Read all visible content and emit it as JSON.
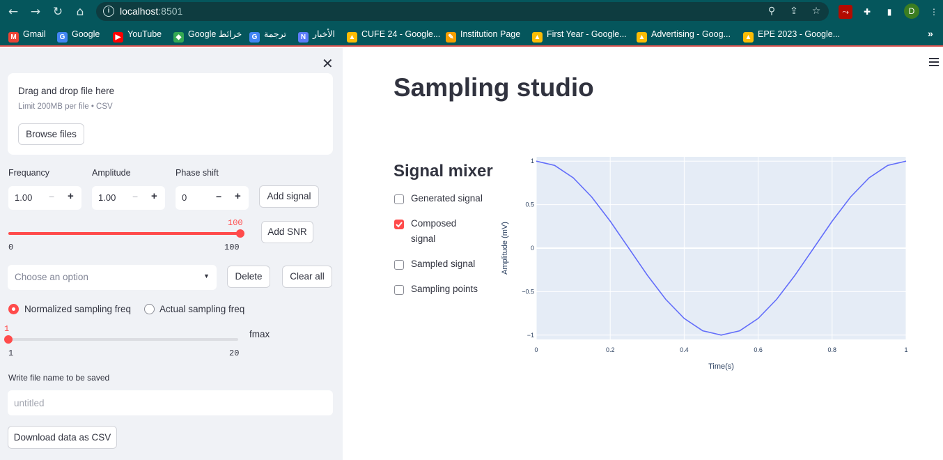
{
  "browser": {
    "url_host": "localhost",
    "url_port": ":8501",
    "avatar_letter": "D",
    "more_bookmarks": "»",
    "bookmarks": [
      {
        "label": "Gmail",
        "icon": "gmail-icon",
        "color": "#ea4335",
        "glyph": "M"
      },
      {
        "label": "Google",
        "icon": "google-icon",
        "color": "#4285f4",
        "glyph": "G"
      },
      {
        "label": "YouTube",
        "icon": "youtube-icon",
        "color": "#ff0000",
        "glyph": "▶"
      },
      {
        "label": "Google خرائط",
        "icon": "maps-icon",
        "color": "#34a853",
        "glyph": "◆"
      },
      {
        "label": "ترجمة",
        "icon": "translate-icon",
        "color": "#4285f4",
        "glyph": "G"
      },
      {
        "label": "الأخبار",
        "icon": "news-icon",
        "color": "#5c7cfa",
        "glyph": "N"
      },
      {
        "label": "CUFE 24 - Google...",
        "icon": "drive-icon",
        "color": "#fbbc05",
        "glyph": "▲"
      },
      {
        "label": "Institution Page",
        "icon": "institution-icon",
        "color": "#f59f00",
        "glyph": "✎"
      },
      {
        "label": "First Year - Google...",
        "icon": "drive-icon",
        "color": "#fbbc05",
        "glyph": "▲"
      },
      {
        "label": "Advertising - Goog...",
        "icon": "drive-icon",
        "color": "#fbbc05",
        "glyph": "▲"
      },
      {
        "label": "EPE 2023 - Google...",
        "icon": "drive-icon",
        "color": "#fbbc05",
        "glyph": "▲"
      }
    ]
  },
  "sidebar": {
    "uploader_title": "Drag and drop file here",
    "uploader_limit": "Limit 200MB per file • CSV",
    "browse_label": "Browse files",
    "frequency_label": "Frequancy",
    "frequency_value": "1.00",
    "amplitude_label": "Amplitude",
    "amplitude_value": "1.00",
    "phase_label": "Phase shift",
    "phase_value": "0",
    "minus": "−",
    "plus": "+",
    "add_signal_label": "Add signal",
    "snr_value": "100",
    "snr_min": "0",
    "snr_max": "100",
    "snr_fraction": 1.0,
    "add_snr_label": "Add SNR",
    "select_placeholder": "Choose an option",
    "delete_label": "Delete",
    "clear_label": "Clear all",
    "radio_normalized": "Normalized sampling freq",
    "radio_actual": "Actual sampling freq",
    "radio_selected": "normalized",
    "fs_value": "1",
    "fs_min": "1",
    "fs_max": "20",
    "fs_fraction": 0.0,
    "fmax_label": "fmax",
    "filename_label": "Write file name to be saved",
    "filename_placeholder": "untitled",
    "download_label": "Download data as CSV"
  },
  "main": {
    "title": "Sampling studio",
    "mixer_title": "Signal mixer",
    "checkboxes": [
      {
        "label": "Generated signal",
        "checked": false
      },
      {
        "label": "Composed signal",
        "checked": true
      },
      {
        "label": "Sampled signal",
        "checked": false
      },
      {
        "label": "Sampling points",
        "checked": false
      }
    ]
  },
  "chart_data": {
    "type": "line",
    "title": "",
    "xlabel": "Time(s)",
    "ylabel": "Amplitude (mV)",
    "xlim": [
      0,
      1
    ],
    "ylim": [
      -1.05,
      1.05
    ],
    "xticks": [
      0,
      0.2,
      0.4,
      0.6,
      0.8,
      1
    ],
    "xtick_labels": [
      "0",
      "0.2",
      "0.4",
      "0.6",
      "0.8",
      "1"
    ],
    "yticks": [
      1,
      0.5,
      0,
      -0.5,
      -1
    ],
    "ytick_labels": [
      "1",
      "0.5",
      "0",
      "−0.5",
      "−1"
    ],
    "grid": true,
    "series": [
      {
        "color": "#636efa",
        "x": [
          0,
          0.05,
          0.1,
          0.15,
          0.2,
          0.25,
          0.3,
          0.35,
          0.4,
          0.45,
          0.5,
          0.55,
          0.6,
          0.65,
          0.7,
          0.75,
          0.8,
          0.85,
          0.9,
          0.95,
          1
        ],
        "y": [
          1,
          0.951,
          0.809,
          0.588,
          0.309,
          0,
          -0.309,
          -0.588,
          -0.809,
          -0.951,
          -1,
          -0.951,
          -0.809,
          -0.588,
          -0.309,
          0,
          0.309,
          0.588,
          0.809,
          0.951,
          1
        ]
      }
    ]
  }
}
